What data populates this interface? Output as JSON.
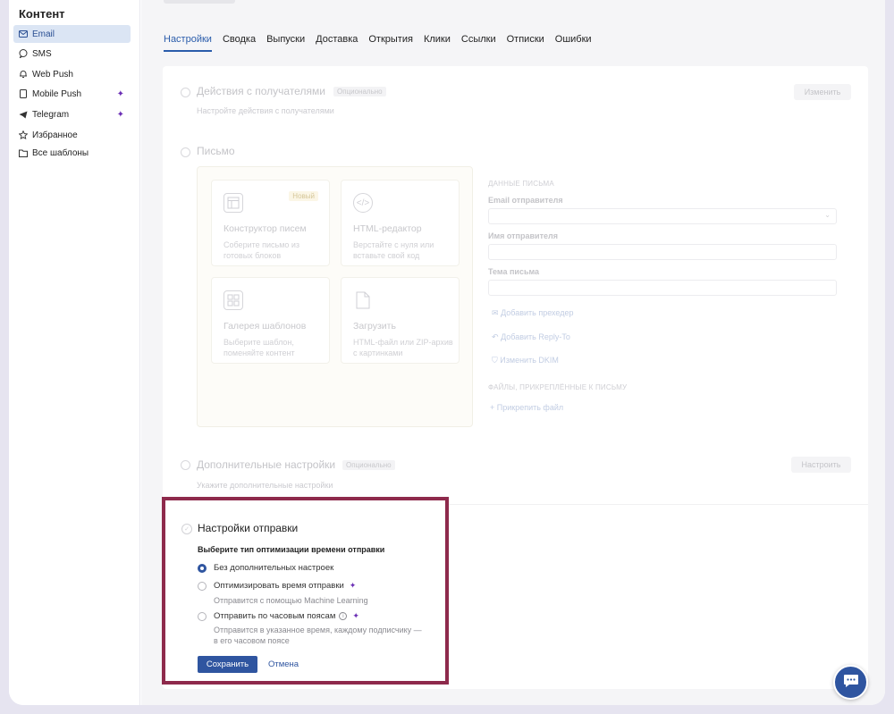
{
  "sidebar": {
    "title": "Контент",
    "items": [
      {
        "label": "Email",
        "icon": "mail-icon"
      },
      {
        "label": "SMS",
        "icon": "chat-bubble-icon"
      },
      {
        "label": "Web Push",
        "icon": "bell-icon"
      },
      {
        "label": "Mobile Push",
        "icon": "phone-icon"
      },
      {
        "label": "Telegram",
        "icon": "telegram-icon"
      },
      {
        "label": "Избранное",
        "icon": "star-icon"
      },
      {
        "label": "Все шаблоны",
        "icon": "folder-icon"
      }
    ]
  },
  "tabs": [
    "Настройки",
    "Сводка",
    "Выпуски",
    "Доставка",
    "Открытия",
    "Клики",
    "Ссылки",
    "Отписки",
    "Ошибки"
  ],
  "recipients": {
    "title": "Действия с получателями",
    "badge": "Опционально",
    "subtitle": "Настройте действия с получателями",
    "button": "Изменить"
  },
  "letter": {
    "title": "Письмо",
    "tiles": [
      {
        "title": "Конструктор писем",
        "desc": "Соберите письмо из готовых блоков",
        "badge": "Новый"
      },
      {
        "title": "HTML-редактор",
        "desc": "Верстайте с нуля или вставьте свой код"
      },
      {
        "title": "Галерея шаблонов",
        "desc": "Выберите шаблон, поменяйте контент"
      },
      {
        "title": "Загрузить",
        "desc": "HTML-файл или ZIP-архив с картинками"
      }
    ],
    "data_heading": "ДАННЫЕ ПИСЬМА",
    "sender_email_label": "Email отправителя",
    "sender_name_label": "Имя отправителя",
    "subject_label": "Тема письма",
    "add_preheader": "Добавить прехедер",
    "add_reply_to": "Добавить Reply-To",
    "change_dkim": "Изменить DKIM",
    "files_heading": "ФАЙЛЫ, ПРИКРЕПЛЁННЫЕ К ПИСЬМУ",
    "attach_file": "+ Прикрепить файл"
  },
  "advanced": {
    "title": "Дополнительные настройки",
    "badge": "Опционально",
    "subtitle": "Укажите дополнительные настройки",
    "button": "Настроить"
  },
  "send_settings": {
    "title": "Настройки отправки",
    "subtitle": "Выберите тип оптимизации времени отправки",
    "options": [
      {
        "label": "Без дополнительных настроек",
        "checked": true
      },
      {
        "label": "Оптимизировать время отправки",
        "desc": "Отправится с помощью Machine Learning"
      },
      {
        "label": "Отправить по часовым поясам",
        "desc_line1": "Отправится в указанное время, каждому подписчику —",
        "desc_line2": "в его часовом поясе"
      }
    ],
    "save": "Сохранить",
    "cancel": "Отмена"
  },
  "colors": {
    "accent": "#2f55a0",
    "highlight_border": "#8e2a4c",
    "ai_sparkle": "#6b2fb5"
  }
}
